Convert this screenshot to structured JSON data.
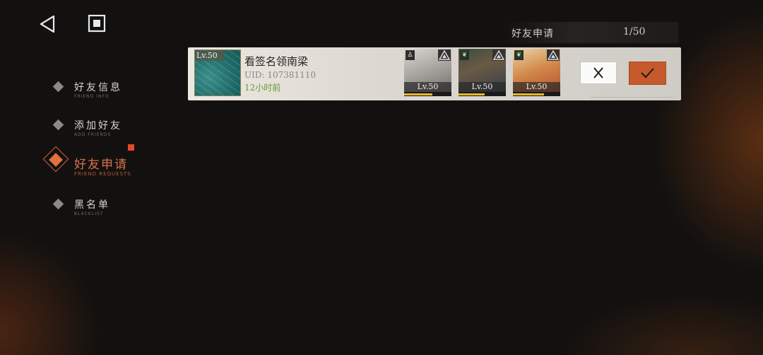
{
  "topbar": {
    "back_icon": "back-triangle-icon",
    "stop_icon": "square-stop-icon"
  },
  "nav": {
    "items": [
      {
        "label": "好友信息",
        "sublabel": "FRIEND INFO"
      },
      {
        "label": "添加好友",
        "sublabel": "ADD FRIENDS"
      },
      {
        "label": "好友申请",
        "sublabel": "FRIEND REQUESTS"
      },
      {
        "label": "黑名单",
        "sublabel": "BLACKLIST"
      }
    ],
    "active_index": 2
  },
  "header": {
    "title": "好友申请",
    "count": "1/50"
  },
  "request": {
    "avatar_level": "Lv.50",
    "name": "看签名领南梁",
    "uid": "UID: 107381110",
    "time": "12小时前",
    "characters": [
      {
        "level": "Lv.50"
      },
      {
        "level": "Lv.50"
      },
      {
        "level": "Lv.50"
      }
    ]
  },
  "colors": {
    "accent": "#d9704a",
    "accept": "#c65a2c",
    "time_green": "#6a9a3a"
  }
}
